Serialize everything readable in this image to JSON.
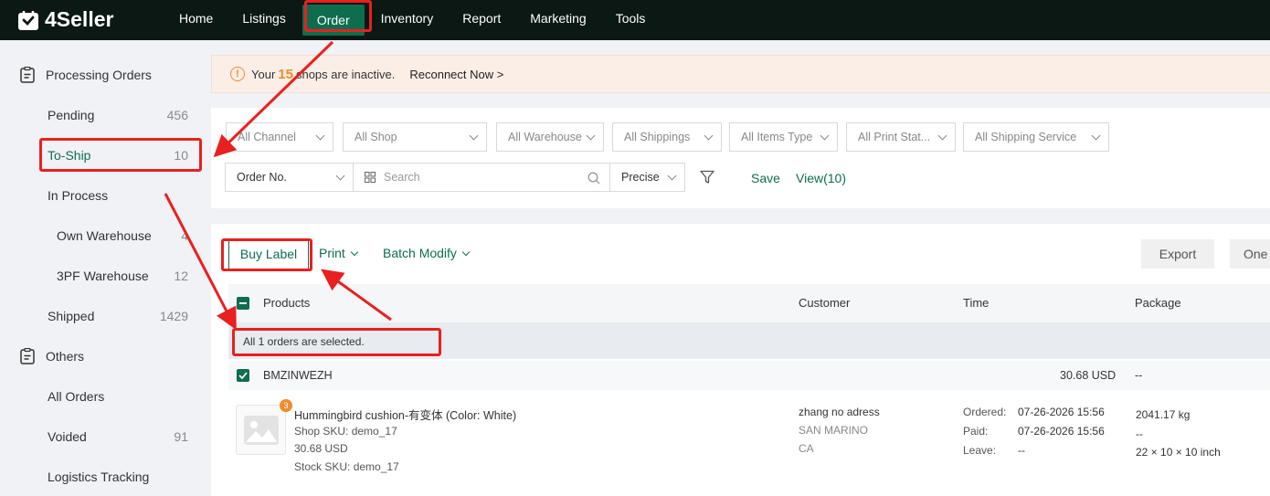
{
  "brand": {
    "name": "4Seller"
  },
  "nav": {
    "items": [
      "Home",
      "Listings",
      "Order",
      "Inventory",
      "Report",
      "Marketing",
      "Tools"
    ],
    "active": "Order"
  },
  "sidebar": {
    "group1": "Processing Orders",
    "pending": {
      "label": "Pending",
      "count": "456"
    },
    "to_ship": {
      "label": "To-Ship",
      "count": "10"
    },
    "in_process": {
      "label": "In Process"
    },
    "own_warehouse": {
      "label": "Own Warehouse",
      "count": "4"
    },
    "tpf_warehouse": {
      "label": "3PF Warehouse",
      "count": "12"
    },
    "shipped": {
      "label": "Shipped",
      "count": "1429"
    },
    "group2": "Others",
    "all_orders": {
      "label": "All Orders"
    },
    "voided": {
      "label": "Voided",
      "count": "91"
    },
    "logistics": {
      "label": "Logistics Tracking"
    }
  },
  "banner": {
    "prefix": "Your",
    "count": "15",
    "suffix": "shops are inactive.",
    "action": "Reconnect Now >"
  },
  "filters": {
    "channel": "All Channel",
    "shop": "All Shop",
    "warehouse": "All Warehouse",
    "shippings": "All Shippings",
    "items_type": "All Items Type",
    "print_status": "All Print Stat...",
    "shipping_service": "All Shipping Service",
    "search_field": "Order No.",
    "search_placeholder": "Search",
    "match_mode": "Precise",
    "save": "Save",
    "view": "View(10)"
  },
  "toolbar": {
    "buy_label": "Buy Label",
    "print": "Print",
    "batch_modify": "Batch Modify",
    "export": "Export",
    "one": "One"
  },
  "table": {
    "headers": {
      "products": "Products",
      "customer": "Customer",
      "time": "Time",
      "package": "Package"
    },
    "selection_msg": "All 1 orders are selected.",
    "order": {
      "id": "BMZINWEZH",
      "total": "30.68 USD",
      "package_head": "--",
      "badge": "3",
      "product_name": "Hummingbird cushion-有变体 (Color: White)",
      "shop_sku": "Shop SKU: demo_17",
      "price": "30.68 USD",
      "stock_sku": "Stock SKU: demo_17",
      "customer_name": "zhang no adress",
      "customer_country": "SAN MARINO",
      "customer_state": "CA",
      "ordered_label": "Ordered:",
      "ordered": "07-26-2026 15:56",
      "paid_label": "Paid:",
      "paid": "07-26-2026 15:56",
      "leave_label": "Leave:",
      "leave": "--",
      "weight": "2041.17 kg",
      "package_mid": "--",
      "dims": "22 × 10 × 10 inch"
    }
  },
  "colors": {
    "accent": "#0e6d4f",
    "annotation": "#e8201f",
    "warning": "#ef8c26"
  }
}
